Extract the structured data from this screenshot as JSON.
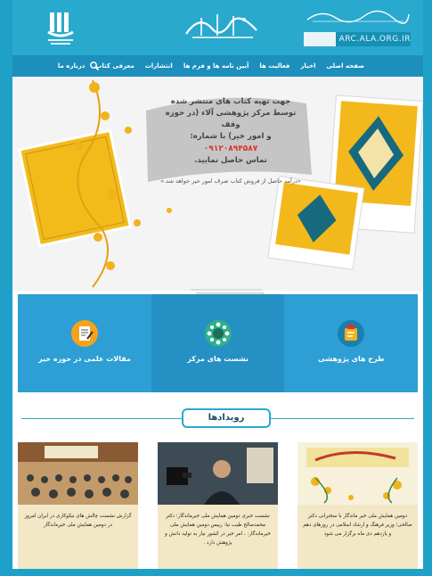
{
  "header": {
    "site_url": "ARC.ALA.ORG.IR"
  },
  "nav": {
    "items": [
      {
        "label": "صفحه اصلی"
      },
      {
        "label": "اخبار"
      },
      {
        "label": "فعالیت ها"
      },
      {
        "label": "آیین نامه ها و فرم ها"
      },
      {
        "label": "انتشارات"
      },
      {
        "label": "معرفی کتاب"
      },
      {
        "label": "درباره ما"
      }
    ]
  },
  "banner": {
    "line1": "جهت تهیه کتاب های منتشر شده",
    "line2": "توسط مرکز پژوهشی آلاء (در حوزه وقف",
    "line3": "و امور خیر) با شماره:",
    "phone": "۰۹۱۲۰۸۹۴۵۸۷",
    "line4": "تماس حاصل نمایید.",
    "footnote": "«درآمد حاصل از فروش کتاب صرف امور خیر خواهد شد.»"
  },
  "tiles": [
    {
      "label": "مقالات علمی در حوزه خیر",
      "color": "#2d9fd4"
    },
    {
      "label": "نشست های مرکز",
      "color": "#2590c4"
    },
    {
      "label": "طرح های پژوهشی",
      "color": "#2d9fd4"
    }
  ],
  "events": {
    "title": "رویدادها",
    "cards": [
      {
        "caption": "گزارش نشست چالش های نیکوکاری در ایران امروز در دومین همایش ملی خیرماندگار"
      },
      {
        "caption": "نشست خبری دومین همایش ملی خیرماندگار؛ دکتر محمدصالح طیب نیا: رییس دومین همایش ملی خیرماندگار: ، امر خیر در کشور نیاز به تولید دانش و پژوهش دارد ."
      },
      {
        "caption": "دومین همایش ملی خیر ماندگار با سخنرانی دکتر صالحی؛ وزیر فرهنگ و ارشاد اسلامی در روزهای دهم و یازدهم دی ماه برگزار می شود"
      }
    ]
  }
}
